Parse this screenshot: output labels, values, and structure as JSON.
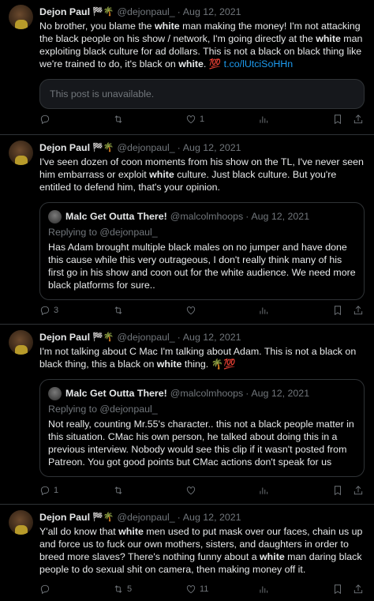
{
  "tweets": [
    {
      "name": "Dejon Paul",
      "badges": "🏁🌴",
      "handle": "@dejonpaul_",
      "date": "Aug 12, 2021",
      "body_parts": [
        "No brother, you blame the ",
        "white",
        " man making the money! I'm not attacking the black people on his show / network, I'm going directly at the ",
        "white",
        " man exploiting black culture for ad dollars. This is not a black on black thing like we're trained to do, it's black on ",
        "white",
        ". ",
        "💯",
        " t.co/lUtciSoHHn"
      ],
      "unavailable": "This post is unavailable.",
      "replies": "",
      "retweets": "",
      "likes": "1",
      "views": ""
    },
    {
      "name": "Dejon Paul",
      "badges": "🏁🌴",
      "handle": "@dejonpaul_",
      "date": "Aug 12, 2021",
      "body_parts": [
        "I've seen dozen of coon moments from his show on the TL, I've never seen him embarrass or exploit ",
        "white",
        " culture. Just black culture. But you're entitled to defend him, that's your opinion."
      ],
      "quote": {
        "name": "Malc Get Outta There!",
        "handle": "@malcolmhoops",
        "date": "Aug 12, 2021",
        "replying": "Replying to @dejonpaul_",
        "body": "Has Adam brought multiple black males on no jumper and have done this cause while this very outrageous, I don't really think many of his first go in his show and coon out for the white audience. We need more black platforms for sure.."
      },
      "replies": "3",
      "retweets": "",
      "likes": "",
      "views": ""
    },
    {
      "name": "Dejon Paul",
      "badges": "🏁🌴",
      "handle": "@dejonpaul_",
      "date": "Aug 12, 2021",
      "body_parts": [
        "I'm not talking about C Mac I'm talking about Adam. This is not a black on black thing, this a black on ",
        "white",
        " thing. ",
        "🌴💯"
      ],
      "quote": {
        "name": "Malc Get Outta There!",
        "handle": "@malcolmhoops",
        "date": "Aug 12, 2021",
        "replying": "Replying to @dejonpaul_",
        "body": "Not really, counting Mr.55's character.. this not a black people matter in this situation. CMac his own person, he talked about doing this in a previous interview. Nobody would see this clip if it wasn't posted from Patreon. You got good points but CMac actions don't speak for us"
      },
      "replies": "1",
      "retweets": "",
      "likes": "",
      "views": ""
    },
    {
      "name": "Dejon Paul",
      "badges": "🏁🌴",
      "handle": "@dejonpaul_",
      "date": "Aug 12, 2021",
      "body_parts": [
        "Y'all do know that ",
        "white",
        " men used to put mask over our faces, chain us up and force us to fuck our own mothers, sisters, and daughters in order to breed more slaves? There's nothing funny about a ",
        "white",
        " man daring black people to do sexual shit on camera, then making money off it."
      ],
      "replies": "",
      "retweets": "5",
      "likes": "11",
      "views": ""
    }
  ],
  "separator": "·"
}
